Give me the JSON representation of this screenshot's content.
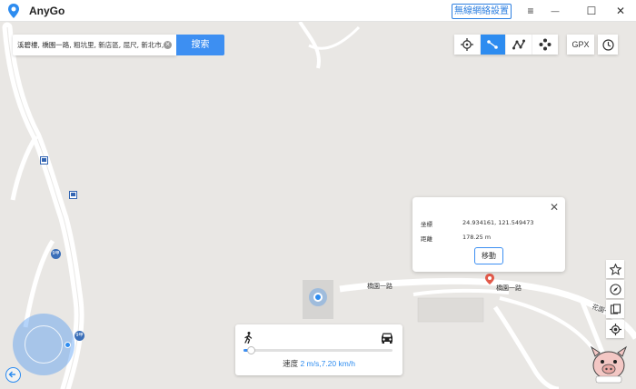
{
  "app": {
    "title": "AnyGo",
    "wireless_label": "無線網絡設置",
    "menu_glyph": "≡",
    "minimize_glyph": "—",
    "maximize_glyph": "☐",
    "close_glyph": "✕"
  },
  "search": {
    "value": "溪碧樓, 橋園一路, 粗坑里, 新店區, 屈尺, 新北市,",
    "clear_glyph": "✕",
    "button_label": "搜索"
  },
  "toolbar": {
    "modes": [
      "teleport-mode",
      "two-spot-mode",
      "multi-spot-mode",
      "joystick-mode"
    ],
    "active_mode": "two-spot-mode",
    "gpx_label": "GPX"
  },
  "popup": {
    "coord_label": "坐標",
    "coord_value": "24.934161, 121.549473",
    "distance_label": "距離",
    "distance_value": "178.25 m",
    "move_label": "移動",
    "close_glyph": "✕"
  },
  "map": {
    "road_labels": [
      "橋園一路",
      "橋園一路",
      "花園一路"
    ],
    "route_shield": "9甲"
  },
  "speed": {
    "label": "速度",
    "value": "2 m/s,7.20 km/h",
    "slider_fraction": 0.05
  },
  "colors": {
    "accent": "#2d8cf0"
  }
}
